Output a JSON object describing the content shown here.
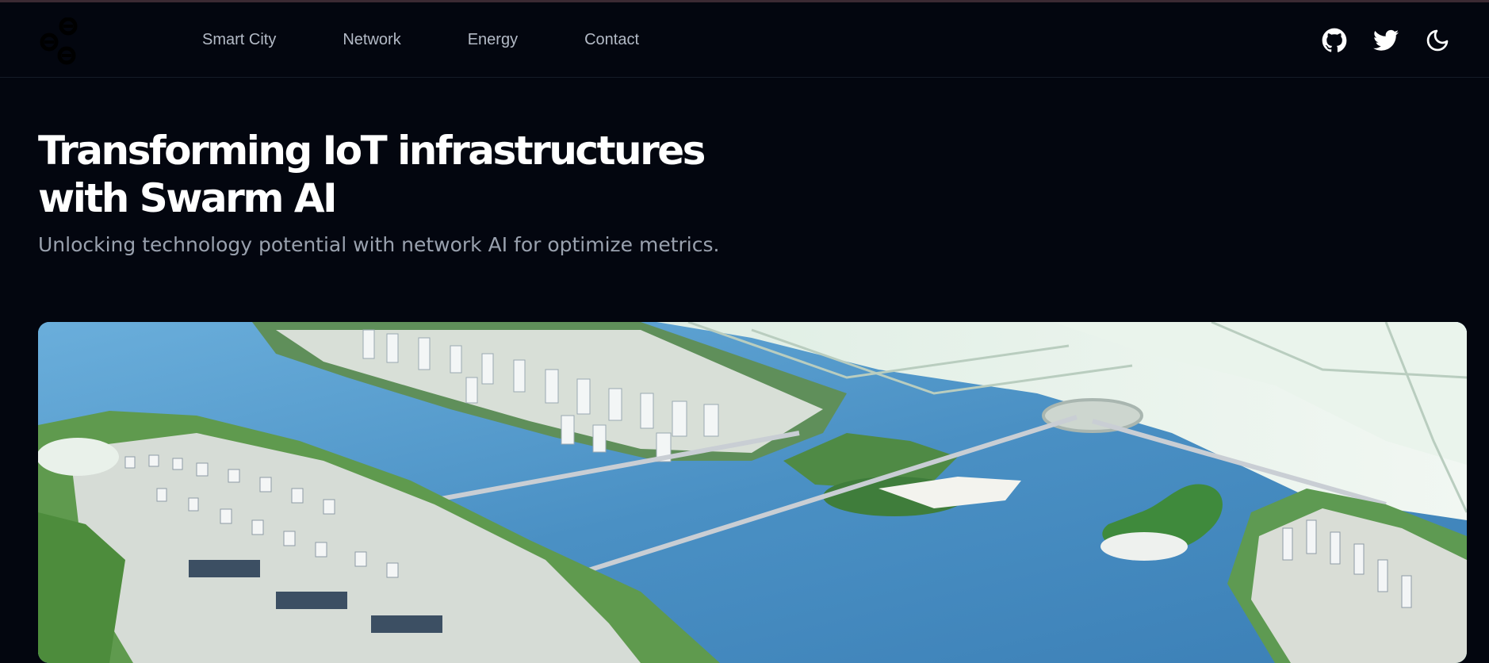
{
  "nav": {
    "items": [
      {
        "label": "Smart City"
      },
      {
        "label": "Network"
      },
      {
        "label": "Energy"
      },
      {
        "label": "Contact"
      }
    ]
  },
  "header_icons": [
    "github-icon",
    "twitter-icon",
    "dark-mode-moon-icon"
  ],
  "hero": {
    "title_line1": "Transforming IoT infrastructures",
    "title_line2": "with Swarm AI",
    "subtitle": "Unlocking technology potential with network AI for optimize metrics."
  },
  "colors": {
    "background": "#03060f",
    "nav_text": "#b3bac6",
    "title": "#ffffff",
    "subtitle": "#99a1ae"
  }
}
